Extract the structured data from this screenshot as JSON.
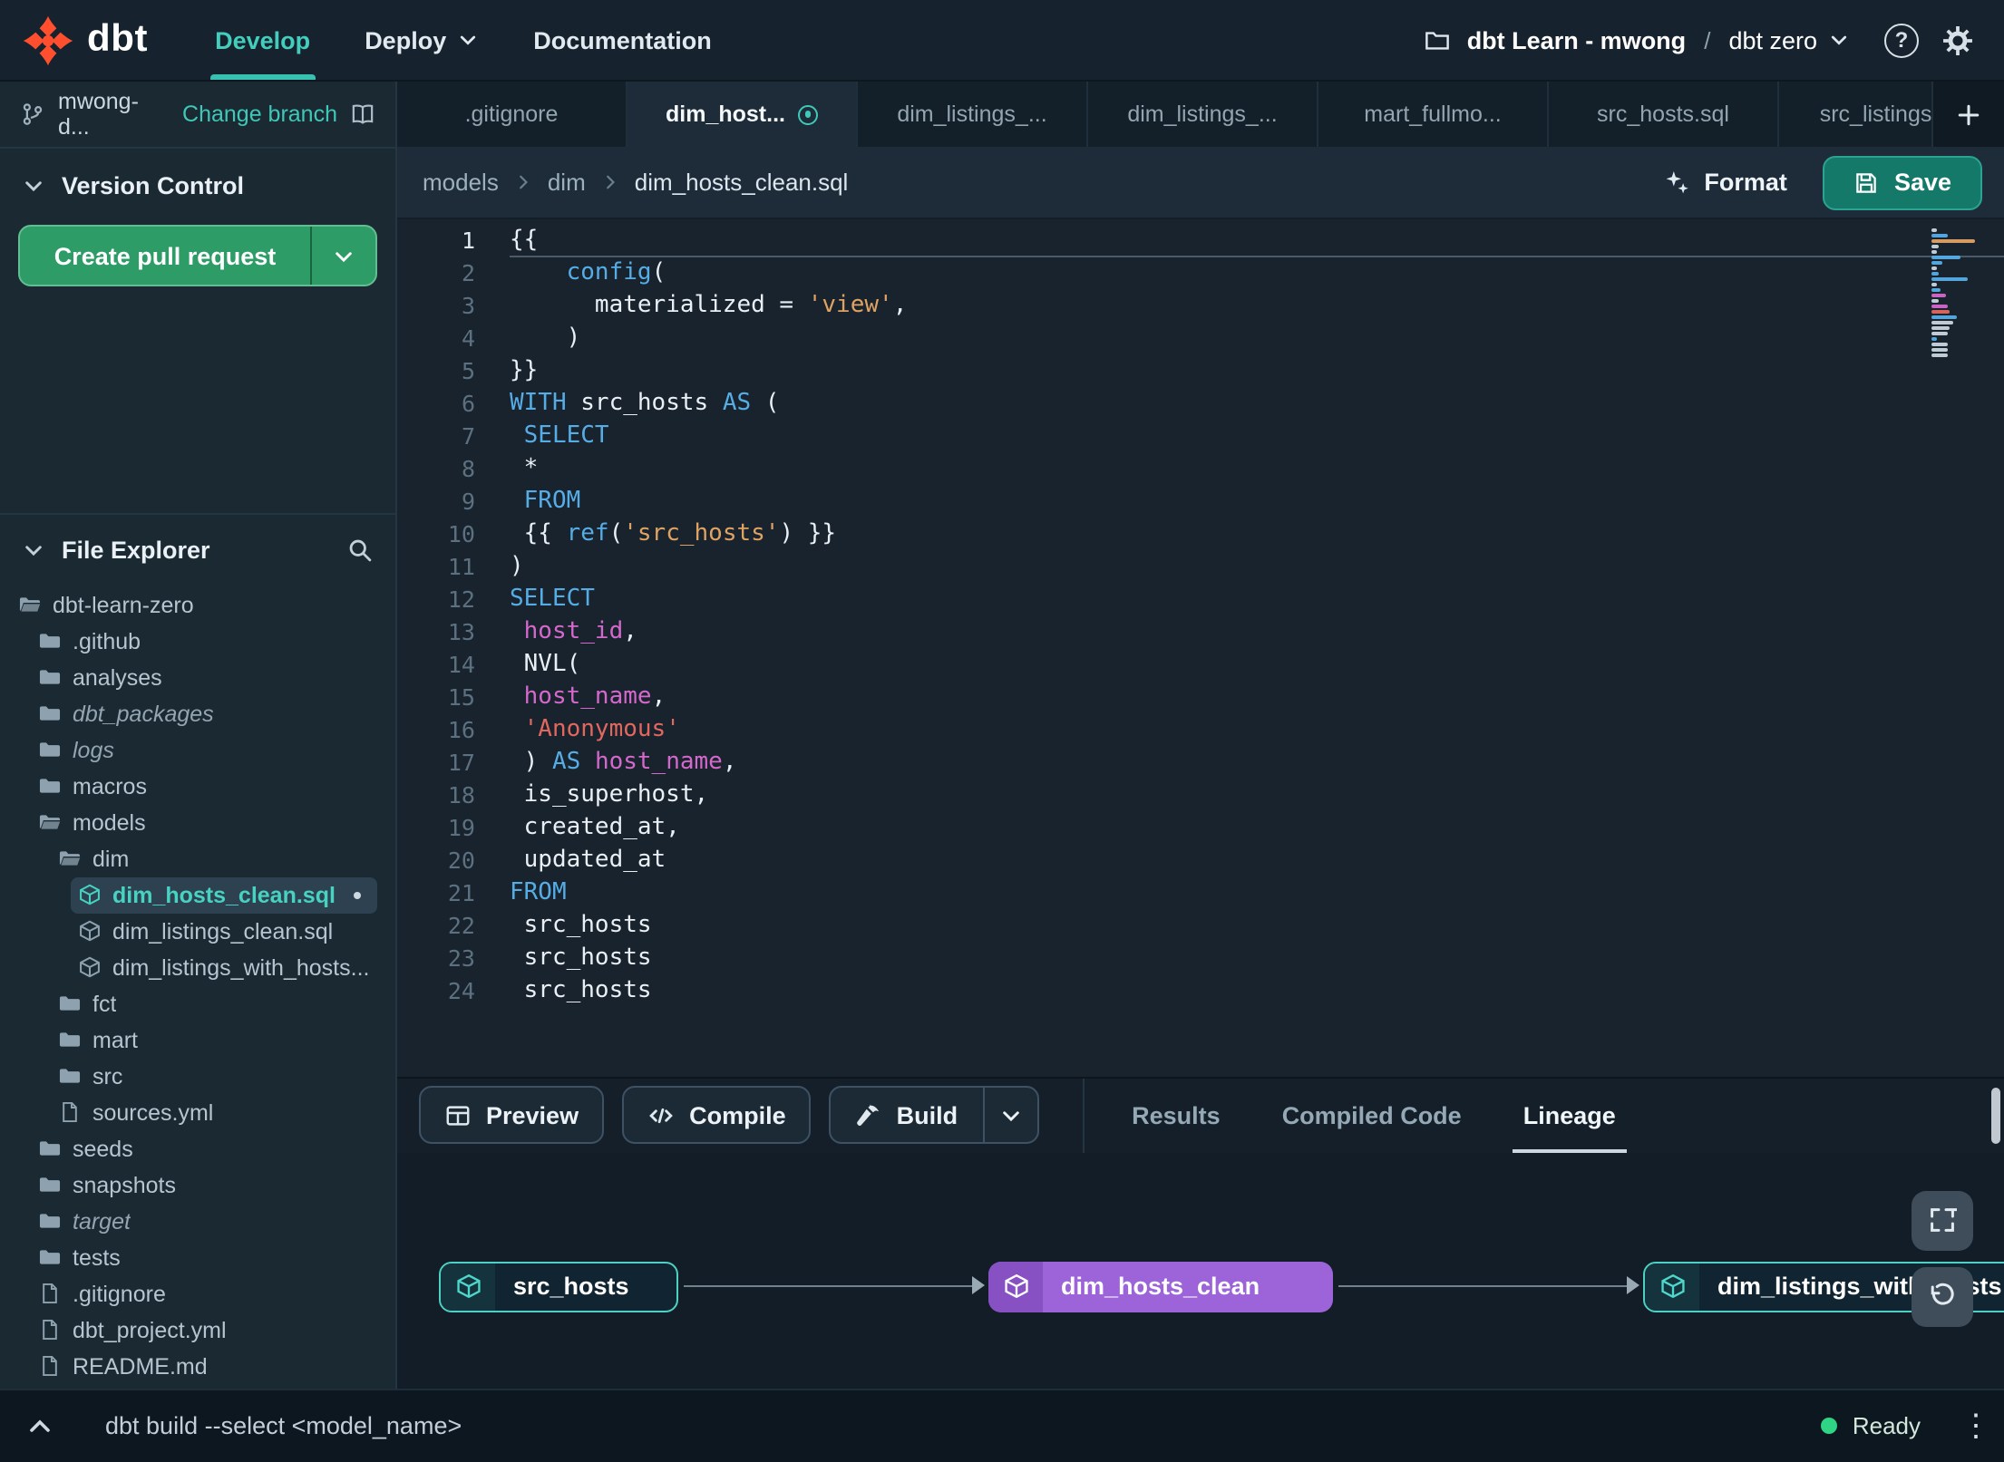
{
  "navbar": {
    "brand": "dbt",
    "items": [
      {
        "label": "Develop",
        "active": true
      },
      {
        "label": "Deploy",
        "dropdown": true
      },
      {
        "label": "Documentation"
      }
    ],
    "project": {
      "name": "dbt Learn - mwong",
      "separator": "/",
      "environment": "dbt zero"
    }
  },
  "sidebar": {
    "branch": {
      "name": "mwong-d...",
      "change_link": "Change branch"
    },
    "version_control": {
      "title": "Version Control",
      "create_pr_label": "Create pull request"
    },
    "file_explorer": {
      "title": "File Explorer"
    },
    "tree": [
      {
        "label": "dbt-learn-zero",
        "type": "folder-open",
        "depth": 0
      },
      {
        "label": ".github",
        "type": "folder",
        "depth": 1
      },
      {
        "label": "analyses",
        "type": "folder",
        "depth": 1
      },
      {
        "label": "dbt_packages",
        "type": "folder",
        "depth": 1,
        "italic": true
      },
      {
        "label": "logs",
        "type": "folder",
        "depth": 1,
        "italic": true
      },
      {
        "label": "macros",
        "type": "folder",
        "depth": 1
      },
      {
        "label": "models",
        "type": "folder-open",
        "depth": 1
      },
      {
        "label": "dim",
        "type": "folder-open",
        "depth": 2
      },
      {
        "label": "dim_hosts_clean.sql",
        "type": "model",
        "depth": 3,
        "selected": true,
        "modified": true
      },
      {
        "label": "dim_listings_clean.sql",
        "type": "model",
        "depth": 3
      },
      {
        "label": "dim_listings_with_hosts...",
        "type": "model",
        "depth": 3
      },
      {
        "label": "fct",
        "type": "folder",
        "depth": 2
      },
      {
        "label": "mart",
        "type": "folder",
        "depth": 2
      },
      {
        "label": "src",
        "type": "folder",
        "depth": 2
      },
      {
        "label": "sources.yml",
        "type": "file",
        "depth": 2
      },
      {
        "label": "seeds",
        "type": "folder",
        "depth": 1
      },
      {
        "label": "snapshots",
        "type": "folder",
        "depth": 1
      },
      {
        "label": "target",
        "type": "folder",
        "depth": 1,
        "italic": true
      },
      {
        "label": "tests",
        "type": "folder",
        "depth": 1
      },
      {
        "label": ".gitignore",
        "type": "file",
        "depth": 1
      },
      {
        "label": "dbt_project.yml",
        "type": "file",
        "depth": 1
      },
      {
        "label": "README.md",
        "type": "file",
        "depth": 1
      }
    ]
  },
  "tabs": {
    "items": [
      {
        "label": ".gitignore"
      },
      {
        "label": "dim_host...",
        "active": true,
        "modified": true
      },
      {
        "label": "dim_listings_..."
      },
      {
        "label": "dim_listings_..."
      },
      {
        "label": "mart_fullmo..."
      },
      {
        "label": "src_hosts.sql"
      },
      {
        "label": "src_listings.sql"
      }
    ]
  },
  "breadcrumb": [
    "models",
    "dim",
    "dim_hosts_clean.sql"
  ],
  "editor_actions": {
    "format": "Format",
    "save": "Save"
  },
  "editor": {
    "current_line": 1,
    "lines": [
      [
        [
          "pl",
          "{{"
        ]
      ],
      [
        [
          "pl",
          "    "
        ],
        [
          "kw",
          "config"
        ],
        [
          "pl",
          "("
        ]
      ],
      [
        [
          "pl",
          "      materialized = "
        ],
        [
          "str",
          "'view'"
        ],
        [
          "pl",
          ","
        ]
      ],
      [
        [
          "pl",
          "    )"
        ]
      ],
      [
        [
          "pl",
          "}}"
        ]
      ],
      [
        [
          "kw",
          "WITH"
        ],
        [
          "pl",
          " src_hosts "
        ],
        [
          "kw",
          "AS"
        ],
        [
          "pl",
          " ("
        ]
      ],
      [
        [
          "pl",
          " "
        ],
        [
          "kw",
          "SELECT"
        ]
      ],
      [
        [
          "pl",
          " *"
        ]
      ],
      [
        [
          "pl",
          " "
        ],
        [
          "kw",
          "FROM"
        ]
      ],
      [
        [
          "pl",
          " {{ "
        ],
        [
          "kw",
          "ref"
        ],
        [
          "pl",
          "("
        ],
        [
          "str",
          "'src_hosts'"
        ],
        [
          "pl",
          ") }}"
        ]
      ],
      [
        [
          "pl",
          ")"
        ]
      ],
      [
        [
          "kw",
          "SELECT"
        ]
      ],
      [
        [
          "pl",
          " "
        ],
        [
          "id",
          "host_id"
        ],
        [
          "pl",
          ","
        ]
      ],
      [
        [
          "pl",
          " NVL("
        ]
      ],
      [
        [
          "pl",
          " "
        ],
        [
          "id",
          "host_name"
        ],
        [
          "pl",
          ","
        ]
      ],
      [
        [
          "pl",
          " "
        ],
        [
          "str2",
          "'Anonymous'"
        ]
      ],
      [
        [
          "pl",
          " ) "
        ],
        [
          "kw",
          "AS"
        ],
        [
          "pl",
          " "
        ],
        [
          "id",
          "host_name"
        ],
        [
          "pl",
          ","
        ]
      ],
      [
        [
          "pl",
          " is_superhost,"
        ]
      ],
      [
        [
          "pl",
          " created_at,"
        ]
      ],
      [
        [
          "pl",
          " updated_at"
        ]
      ],
      [
        [
          "kw",
          "FROM"
        ]
      ],
      [
        [
          "pl",
          " src_hosts"
        ]
      ],
      [
        [
          "pl",
          " src_hosts"
        ]
      ],
      [
        [
          "pl",
          " src_hosts"
        ]
      ]
    ]
  },
  "bottom_toolbar": {
    "preview": "Preview",
    "compile": "Compile",
    "build": "Build",
    "tabs": [
      {
        "label": "Results"
      },
      {
        "label": "Compiled Code"
      },
      {
        "label": "Lineage",
        "active": true
      }
    ]
  },
  "lineage": {
    "nodes": [
      {
        "label": "src_hosts",
        "variant": "source"
      },
      {
        "label": "dim_hosts_clean",
        "variant": "model"
      },
      {
        "label": "dim_listings_with_hosts",
        "variant": "source",
        "clipped": true
      }
    ]
  },
  "status_bar": {
    "command": "dbt build --select <model_name>",
    "status": "Ready"
  },
  "colors": {
    "accent_teal": "#3fc8b8",
    "brand_orange": "#ff4f2e",
    "pr_green": "#2d9c66",
    "save_teal": "#15796a",
    "node_purple": "#9c64d8",
    "node_teal_border": "#4ed0c4",
    "status_green": "#2fd584",
    "keyword_blue": "#56ade6",
    "string_orange": "#dfa263",
    "string_red": "#e2685f",
    "ident_magenta": "#d468cc"
  }
}
